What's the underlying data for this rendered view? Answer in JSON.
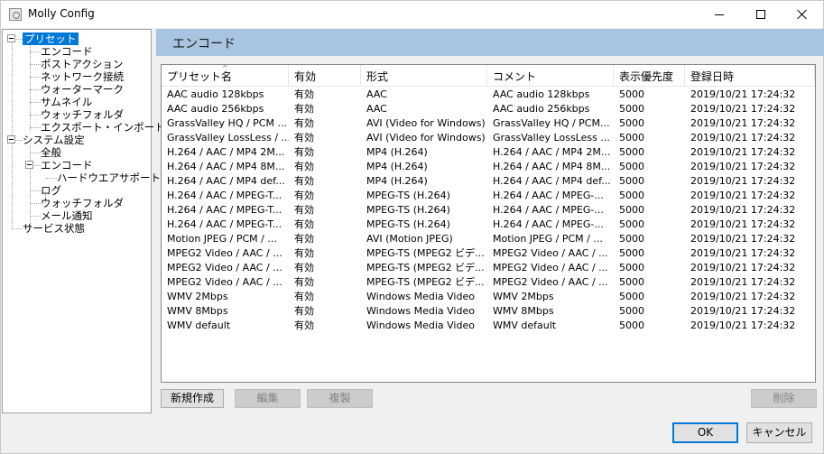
{
  "window": {
    "title": "Molly Config"
  },
  "tree": {
    "items": [
      {
        "label": "プリセット",
        "depth": 0,
        "selected": true,
        "expandable": true
      },
      {
        "label": "エンコード",
        "depth": 1
      },
      {
        "label": "ポストアクション",
        "depth": 1
      },
      {
        "label": "ネットワーク接続",
        "depth": 1
      },
      {
        "label": "ウォーターマーク",
        "depth": 1
      },
      {
        "label": "サムネイル",
        "depth": 1
      },
      {
        "label": "ウォッチフォルダ",
        "depth": 1
      },
      {
        "label": "エクスポート・インポート",
        "depth": 1
      },
      {
        "label": "システム設定",
        "depth": 0,
        "expandable": true
      },
      {
        "label": "全般",
        "depth": 1
      },
      {
        "label": "エンコード",
        "depth": 1,
        "expandable": true
      },
      {
        "label": "ハードウエアサポート",
        "depth": 2
      },
      {
        "label": "ログ",
        "depth": 1
      },
      {
        "label": "ウォッチフォルダ",
        "depth": 1
      },
      {
        "label": "メール通知",
        "depth": 1
      },
      {
        "label": "サービス状態",
        "depth": 0
      }
    ]
  },
  "panel": {
    "title": "エンコード"
  },
  "list": {
    "columns": [
      "プリセット名",
      "有効",
      "形式",
      "コメント",
      "表示優先度",
      "登録日時"
    ],
    "rows": [
      [
        "AAC audio 128kbps",
        "有効",
        "AAC",
        "AAC audio 128kbps",
        "5000",
        "2019/10/21 17:24:32"
      ],
      [
        "AAC audio 256kbps",
        "有効",
        "AAC",
        "AAC audio 256kbps",
        "5000",
        "2019/10/21 17:24:32"
      ],
      [
        "GrassValley HQ / PCM ...",
        "有効",
        "AVI (Video for Windows)",
        "GrassValley HQ / PCM...",
        "5000",
        "2019/10/21 17:24:32"
      ],
      [
        "GrassValley LossLess / ...",
        "有効",
        "AVI (Video for Windows)",
        "GrassValley LossLess ...",
        "5000",
        "2019/10/21 17:24:32"
      ],
      [
        "H.264 / AAC / MP4 2M...",
        "有効",
        "MP4 (H.264)",
        "H.264 / AAC / MP4 2M...",
        "5000",
        "2019/10/21 17:24:32"
      ],
      [
        "H.264 / AAC / MP4 8M...",
        "有効",
        "MP4 (H.264)",
        "H.264 / AAC / MP4 8M...",
        "5000",
        "2019/10/21 17:24:32"
      ],
      [
        "H.264 / AAC / MP4 def...",
        "有効",
        "MP4 (H.264)",
        "H.264 / AAC / MP4 def...",
        "5000",
        "2019/10/21 17:24:32"
      ],
      [
        "H.264 / AAC / MPEG-T...",
        "有効",
        "MPEG-TS (H.264)",
        "H.264 / AAC / MPEG-...",
        "5000",
        "2019/10/21 17:24:32"
      ],
      [
        "H.264 / AAC / MPEG-T...",
        "有効",
        "MPEG-TS (H.264)",
        "H.264 / AAC / MPEG-...",
        "5000",
        "2019/10/21 17:24:32"
      ],
      [
        "H.264 / AAC / MPEG-T...",
        "有効",
        "MPEG-TS (H.264)",
        "H.264 / AAC / MPEG-...",
        "5000",
        "2019/10/21 17:24:32"
      ],
      [
        "Motion JPEG / PCM / ...",
        "有効",
        "AVI (Motion JPEG)",
        "Motion JPEG / PCM / ...",
        "5000",
        "2019/10/21 17:24:32"
      ],
      [
        "MPEG2 Video / AAC / ...",
        "有効",
        "MPEG-TS (MPEG2 ビデ...",
        "MPEG2 Video / AAC / ...",
        "5000",
        "2019/10/21 17:24:32"
      ],
      [
        "MPEG2 Video / AAC / ...",
        "有効",
        "MPEG-TS (MPEG2 ビデ...",
        "MPEG2 Video / AAC / ...",
        "5000",
        "2019/10/21 17:24:32"
      ],
      [
        "MPEG2 Video / AAC / ...",
        "有効",
        "MPEG-TS (MPEG2 ビデ...",
        "MPEG2 Video / AAC / ...",
        "5000",
        "2019/10/21 17:24:32"
      ],
      [
        "WMV 2Mbps",
        "有効",
        "Windows Media Video",
        "WMV 2Mbps",
        "5000",
        "2019/10/21 17:24:32"
      ],
      [
        "WMV 8Mbps",
        "有効",
        "Windows Media Video",
        "WMV 8Mbps",
        "5000",
        "2019/10/21 17:24:32"
      ],
      [
        "WMV default",
        "有効",
        "Windows Media Video",
        "WMV default",
        "5000",
        "2019/10/21 17:24:32"
      ]
    ]
  },
  "buttons": {
    "new": "新規作成",
    "edit": "編集",
    "copy": "複製",
    "delete": "削除",
    "ok": "OK",
    "cancel": "キャンセル"
  },
  "colors": {
    "accent": "#0078d7",
    "header_bar": "#a8c4e0"
  }
}
